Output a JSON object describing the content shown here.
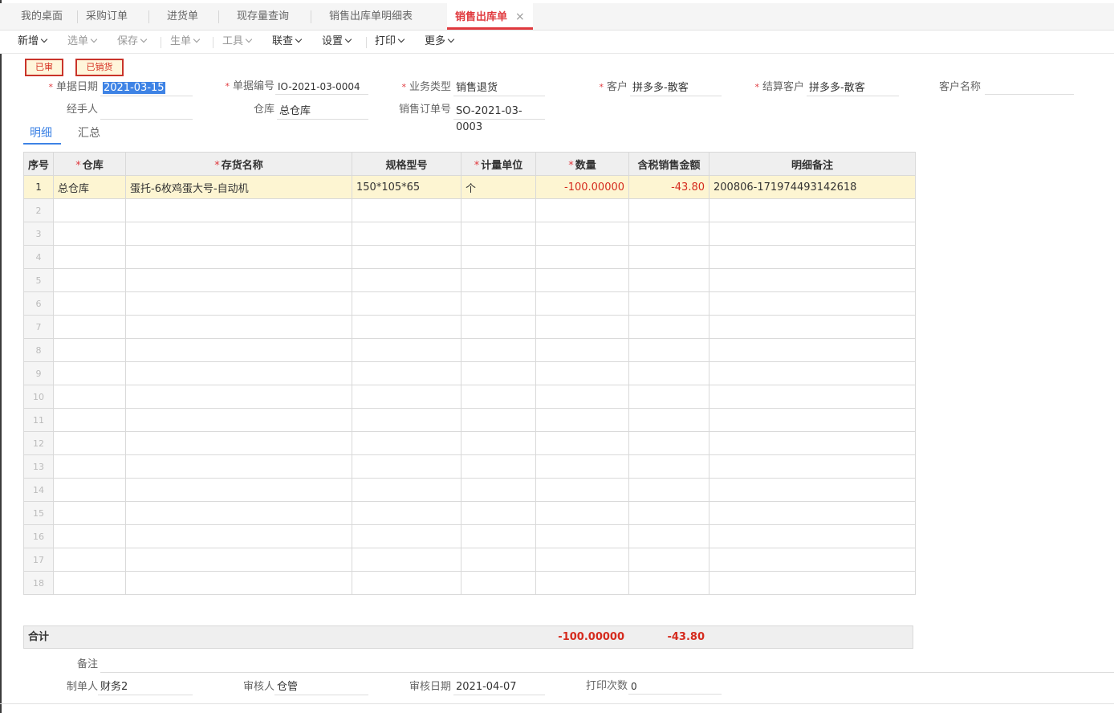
{
  "tabs": [
    {
      "label": "我的桌面"
    },
    {
      "label": "采购订单"
    },
    {
      "label": "进货单"
    },
    {
      "label": "现存量查询"
    },
    {
      "label": "销售出库单明细表"
    },
    {
      "label": "销售出库单",
      "close": "×"
    }
  ],
  "toolbar": {
    "new": "新增",
    "select": "选单",
    "save": "保存",
    "generate": "生单",
    "tools": "工具",
    "linked": "联查",
    "settings": "设置",
    "print": "打印",
    "more": "更多"
  },
  "badges": {
    "audited": "已审",
    "sales_done": "已销货"
  },
  "form": {
    "date_label": "单据日期",
    "date": "2021-03-15",
    "docno_label": "单据编号",
    "docno": "IO-2021-03-0004",
    "biztype_label": "业务类型",
    "biztype": "销售退货",
    "customer_label": "客户",
    "customer": "拼多多-散客",
    "settle_label": "结算客户",
    "settle": "拼多多-散客",
    "custname_label": "客户名称",
    "custname": "",
    "handler_label": "经手人",
    "handler": "",
    "warehouse_label": "仓库",
    "warehouse": "总仓库",
    "order_label": "销售订单号",
    "order": "SO-2021-03-0003"
  },
  "subtabs": {
    "detail": "明细",
    "summary": "汇总"
  },
  "grid": {
    "headers": {
      "idx": "序号",
      "warehouse": "仓库",
      "name": "存货名称",
      "spec": "规格型号",
      "unit": "计量单位",
      "qty": "数量",
      "amount": "含税销售金额",
      "remark": "明细备注"
    },
    "rows": [
      {
        "idx": "1",
        "warehouse": "总仓库",
        "name": "蛋托-6枚鸡蛋大号-自动机",
        "spec": "150*105*65",
        "unit": "个",
        "qty": "-100.00000",
        "amount": "-43.80",
        "remark": "200806-171974493142618"
      },
      {
        "idx": "2"
      },
      {
        "idx": "3"
      },
      {
        "idx": "4"
      },
      {
        "idx": "5"
      },
      {
        "idx": "6"
      },
      {
        "idx": "7"
      },
      {
        "idx": "8"
      },
      {
        "idx": "9"
      },
      {
        "idx": "10"
      },
      {
        "idx": "11"
      },
      {
        "idx": "12"
      },
      {
        "idx": "13"
      },
      {
        "idx": "14"
      },
      {
        "idx": "15"
      },
      {
        "idx": "16"
      },
      {
        "idx": "17"
      },
      {
        "idx": "18"
      }
    ]
  },
  "totals": {
    "label": "合计",
    "qty": "-100.00000",
    "amount": "-43.80"
  },
  "footer": {
    "memo_label": "备注",
    "memo": "",
    "maker_label": "制单人",
    "maker": "财务2",
    "auditor_label": "审核人",
    "auditor": "仓管",
    "audit_date_label": "审核日期",
    "audit_date": "2021-04-07",
    "print_count_label": "打印次数",
    "print_count": "0"
  },
  "colors": {
    "accent": "#e0393e",
    "link": "#3e83e5",
    "highlight": "#fdf5d2"
  }
}
